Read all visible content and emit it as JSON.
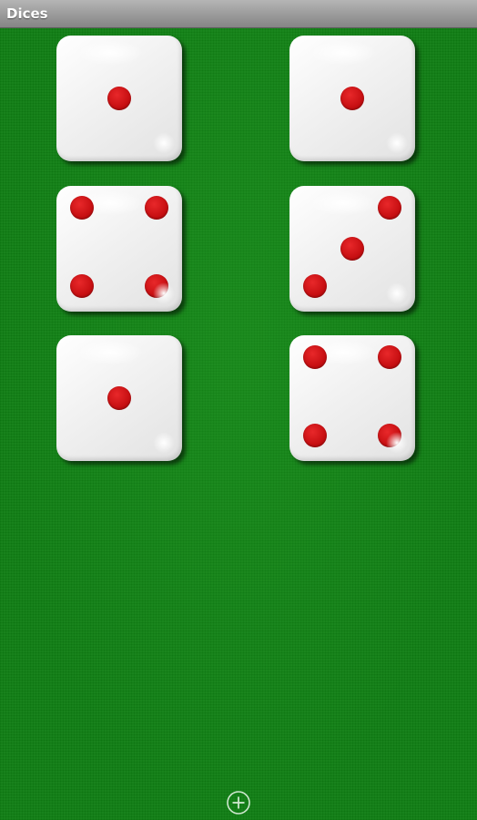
{
  "app": {
    "title": "Dices"
  },
  "dice": [
    {
      "value": 1
    },
    {
      "value": 1
    },
    {
      "value": 4
    },
    {
      "value": 3
    },
    {
      "value": 1
    },
    {
      "value": 4
    }
  ],
  "colors": {
    "felt": "#0f7e13",
    "pip": "#c70f12",
    "die": "#f1f1f1",
    "titlebar": "#9a9a9a"
  },
  "icons": {
    "add": "plus-circle-icon"
  }
}
